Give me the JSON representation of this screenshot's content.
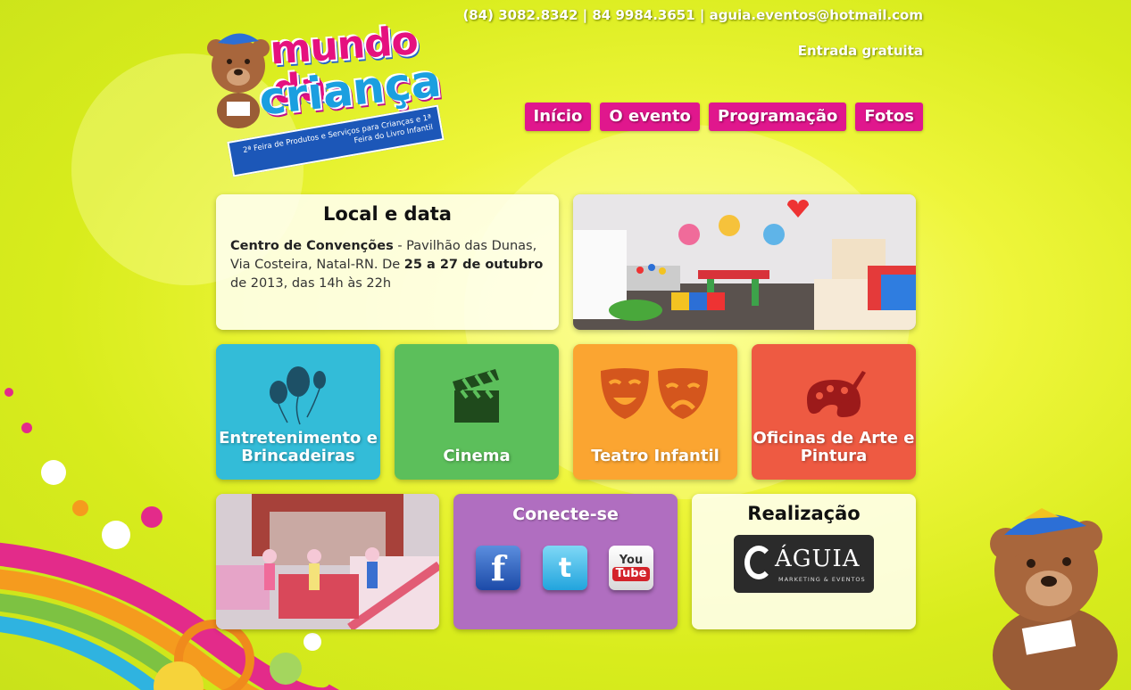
{
  "header": {
    "logo": {
      "title_line1": "mundo da",
      "title_line2": "criança",
      "ribbon": "2ª Feira de Produtos e Serviços para Crianças e 1ª Feira do Livro Infantil"
    },
    "contact": "(84) 3082.8342  |  84 9984.3651  |  aguia.eventos@hotmail.com",
    "entrada": "Entrada gratuita"
  },
  "nav": {
    "items": [
      "Início",
      "O evento",
      "Programação",
      "Fotos"
    ]
  },
  "info": {
    "title": "Local e data",
    "place_bold": "Centro de Convenções",
    "place_rest": " - Pavilhão das Dunas, Via Costeira, Natal-RN. De ",
    "date_bold": "25 a 27 de outubro",
    "date_rest": " de 2013, das 14h às 22h"
  },
  "tiles": [
    {
      "label": "Entretenimento e Brincadeiras",
      "color": "#33bcd8",
      "icon": "balloons-icon"
    },
    {
      "label": "Cinema",
      "color": "#5cbf5b",
      "icon": "clapperboard-icon"
    },
    {
      "label": "Teatro Infantil",
      "color": "#fba531",
      "icon": "theater-masks-icon"
    },
    {
      "label": "Oficinas de Arte e Pintura",
      "color": "#ee5a42",
      "icon": "paint-palette-icon"
    }
  ],
  "social": {
    "title": "Conecte-se",
    "facebook": "f",
    "twitter": "t",
    "youtube_you": "You",
    "youtube_tube": "Tube"
  },
  "realizacao": {
    "title": "Realização",
    "logo_name": "ÁGUIA",
    "logo_sub": "MARKETING & EVENTOS"
  },
  "colors": {
    "accent": "#e0178d",
    "background": "#dff02a"
  }
}
